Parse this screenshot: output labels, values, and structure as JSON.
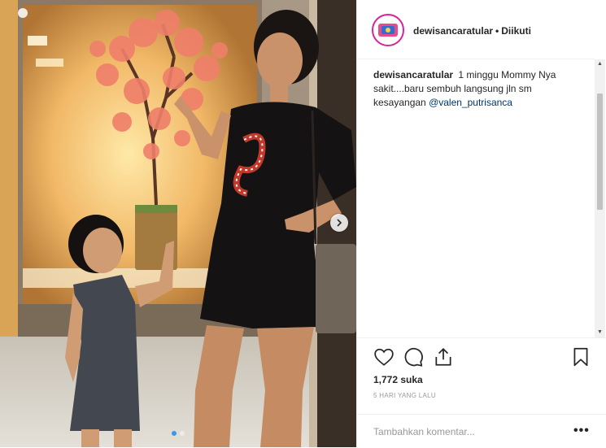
{
  "post": {
    "username": "dewisancaratular",
    "separator": "•",
    "follow_status": "Diikuti",
    "caption_text": "1 minggu Mommy Nya sakit....baru sembuh langsung jln sm kesayangan",
    "caption_mention": "@valen_putrisanca",
    "likes": "1,772 suka",
    "timestamp": "5 HARI YANG LALU",
    "comment_placeholder": "Tambahkan komentar...",
    "more_label": "•••"
  },
  "carousel": {
    "slide_count": 2,
    "active_slide": 1
  },
  "icons": {
    "like": "heart-icon",
    "comment": "comment-icon",
    "share": "share-icon",
    "save": "bookmark-icon",
    "next": "chevron-right-icon",
    "more": "more-options-icon"
  },
  "colors": {
    "text": "#262626",
    "secondary_text": "#999999",
    "mention": "#003569",
    "border": "#efefef",
    "story_ring": "#d6249f",
    "carousel_active": "#3897f0"
  }
}
